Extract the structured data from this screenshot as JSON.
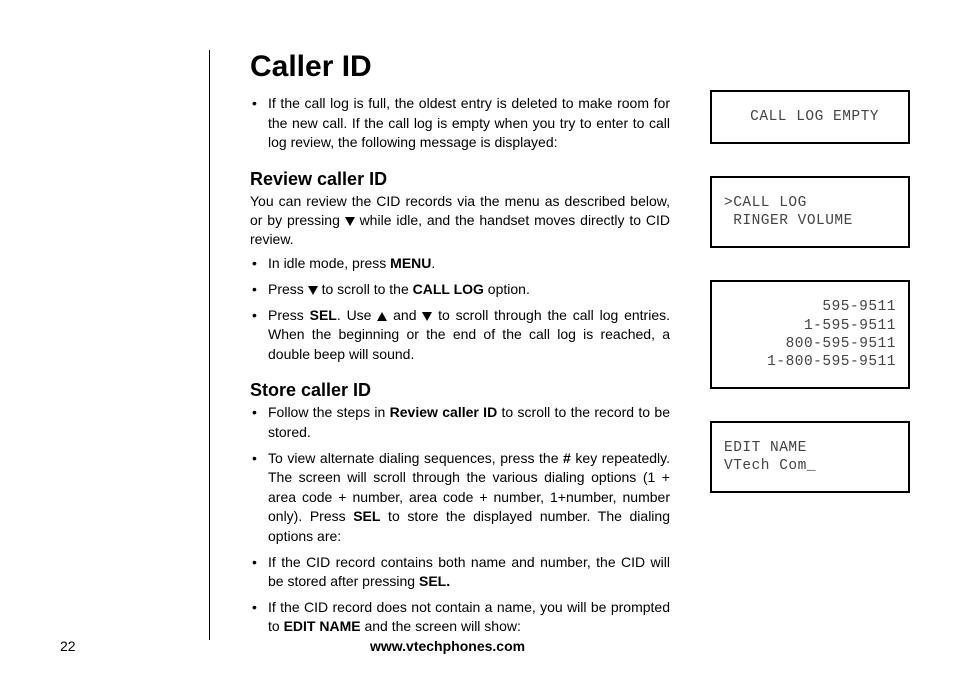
{
  "page": {
    "title": "Caller ID",
    "intro_bullet": {
      "text": "If the call log is full, the oldest entry is deleted to make room for the new call. If the call log is empty when you try to enter to call log review, the following message is displayed:"
    },
    "review": {
      "heading": "Review caller ID",
      "lead_a": "You can review the CID records via the menu as described below, or by pressing ",
      "lead_b": " while idle, and the handset moves directly to CID review.",
      "b1_a": "In idle mode, press ",
      "b1_menu": "MENU",
      "b1_b": ".",
      "b2_a": "Press ",
      "b2_b": " to scroll to the  ",
      "b2_call_log": "CALL LOG",
      "b2_c": " option.",
      "b3_a": "Press ",
      "b3_sel": "SEL",
      "b3_b": ". Use ",
      "b3_c": " and ",
      "b3_d": " to scroll through the call log entries. When the beginning or the end of the call log is reached, a double beep will sound."
    },
    "store": {
      "heading": "Store caller ID",
      "b1_a": "Follow the steps in ",
      "b1_ref": "Review caller ID",
      "b1_b": " to scroll to the record to be stored.",
      "b2_a": "To view alternate dialing sequences, press the ",
      "b2_hash": "#",
      "b2_b": " key repeatedly. The screen will scroll through the various dialing options (1 + area code + number, area code + number, 1+number, number only). Press ",
      "b2_sel": "SEL",
      "b2_c": " to store the displayed number. The dialing options are:",
      "b3_a": "If the CID record contains both name and number, the CID will be stored after pressing ",
      "b3_sel": "SEL.",
      "b4_a": "If the CID record does not contain a name, you will be prompted to ",
      "b4_edit": "EDIT NAME",
      "b4_b": " and the screen will show:"
    }
  },
  "lcd": {
    "empty": " CALL LOG EMPTY",
    "menu": ">CALL LOG\n RINGER VOLUME",
    "numbers": "595-9511\n1-595-9511\n800-595-9511\n1-800-595-9511",
    "edit": "EDIT NAME\nVTech Com_"
  },
  "footer": {
    "page_number": "22",
    "url": "www.vtechphones.com"
  }
}
